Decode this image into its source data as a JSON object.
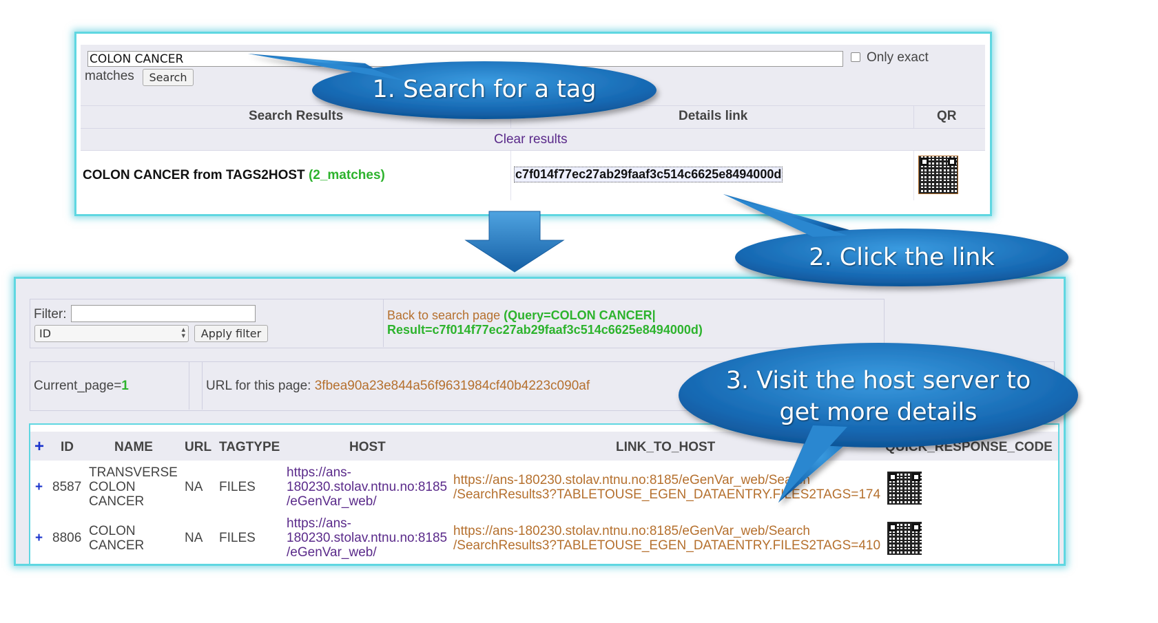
{
  "search_panel": {
    "query_value": "COLON CANCER",
    "only_exact_label": "Only exact",
    "matches_label": "matches",
    "search_button": "Search",
    "headers": {
      "results": "Search Results",
      "details": "Details link",
      "qr": "QR"
    },
    "clear_results": "Clear results",
    "result": {
      "title": "COLON CANCER from TAGS2HOST",
      "matches": "(2_matches)",
      "hash": "c7f014f77ec27ab29faaf3c514c6625e8494000d"
    }
  },
  "details_panel": {
    "filter_label": "Filter:",
    "filter_value": "",
    "select_value": "ID",
    "apply_filter": "Apply filter",
    "back_link": "Back to search page",
    "query_line": "(Query=COLON CANCER|",
    "result_line": "Result=c7f014f77ec27ab29faaf3c514c6625e8494000d)",
    "current_page_label": "Current_page=",
    "current_page_value": "1",
    "url_label": "URL for this page:",
    "url_value": "3fbea90a23e844a56f9631984cf40b4223c090af",
    "table": {
      "expand_all": "+",
      "columns": [
        "ID",
        "NAME",
        "URL",
        "TAGTYPE",
        "HOST",
        "LINK_TO_HOST",
        "QUICK_RESPONSE_CODE"
      ],
      "rows": [
        {
          "expand": "+",
          "id": "8587",
          "name": [
            "TRANSVERSE",
            "COLON",
            "CANCER"
          ],
          "url": "NA",
          "tagtype": "FILES",
          "host": [
            "https://ans-",
            "180230.stolav.ntnu.no:8185",
            "/eGenVar_web/"
          ],
          "link": [
            "https://ans-180230.stolav.ntnu.no:8185/eGenVar_web/Search",
            "/SearchResults3?TABLETOUSE_EGEN_DATAENTRY.FILES2TAGS=174"
          ]
        },
        {
          "expand": "+",
          "id": "8806",
          "name": [
            "COLON",
            "CANCER"
          ],
          "url": "NA",
          "tagtype": "FILES",
          "host": [
            "https://ans-",
            "180230.stolav.ntnu.no:8185",
            "/eGenVar_web/"
          ],
          "link": [
            "https://ans-180230.stolav.ntnu.no:8185/eGenVar_web/Search",
            "/SearchResults3?TABLETOUSE_EGEN_DATAENTRY.FILES2TAGS=410"
          ]
        }
      ]
    }
  },
  "callouts": {
    "step1": "1. Search for a tag",
    "step2": "2. Click the link",
    "step3_line1": "3. Visit the host server to",
    "step3_line2": "get more details"
  },
  "colors": {
    "panel_border": "#5fd7e1",
    "callout_blue": "#1f7fc4",
    "green_text": "#2db32d",
    "link_purple": "#5a2a8a",
    "link_orange": "#b5702e",
    "arrow_blue": "#1d79c2"
  }
}
